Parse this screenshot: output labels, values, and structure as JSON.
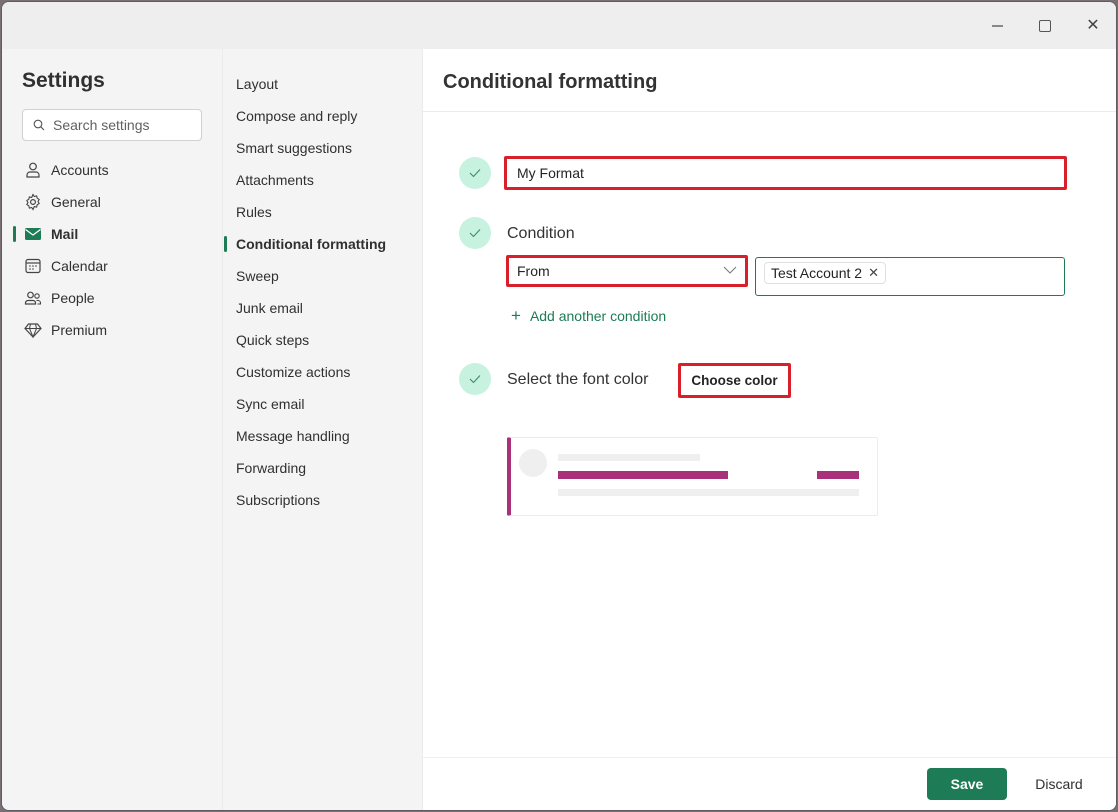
{
  "window": {
    "controls": {
      "minimize": "minimize-icon",
      "maximize": "maximize-icon",
      "close": "close-icon"
    }
  },
  "sidebar": {
    "title": "Settings",
    "search": {
      "placeholder": "Search settings",
      "value": ""
    },
    "items": [
      {
        "label": "Accounts",
        "icon": "person-icon",
        "active": false
      },
      {
        "label": "General",
        "icon": "gear-icon",
        "active": false
      },
      {
        "label": "Mail",
        "icon": "mail-icon",
        "active": true
      },
      {
        "label": "Calendar",
        "icon": "calendar-icon",
        "active": false
      },
      {
        "label": "People",
        "icon": "people-icon",
        "active": false
      },
      {
        "label": "Premium",
        "icon": "diamond-icon",
        "active": false
      }
    ]
  },
  "subnav": {
    "items": [
      {
        "label": "Layout"
      },
      {
        "label": "Compose and reply"
      },
      {
        "label": "Smart suggestions"
      },
      {
        "label": "Attachments"
      },
      {
        "label": "Rules"
      },
      {
        "label": "Conditional formatting",
        "active": true
      },
      {
        "label": "Sweep"
      },
      {
        "label": "Junk email"
      },
      {
        "label": "Quick steps"
      },
      {
        "label": "Customize actions"
      },
      {
        "label": "Sync email"
      },
      {
        "label": "Message handling"
      },
      {
        "label": "Forwarding"
      },
      {
        "label": "Subscriptions"
      }
    ]
  },
  "main": {
    "title": "Conditional formatting",
    "rule_name": {
      "value": "My Format"
    },
    "condition": {
      "label": "Condition",
      "field": "From",
      "recipients": [
        {
          "name": "Test Account 2"
        }
      ],
      "add_label": "Add another condition"
    },
    "font_color": {
      "label": "Select the font color",
      "button_label": "Choose color",
      "preview_color": "#a9317b"
    },
    "footer": {
      "save_label": "Save",
      "discard_label": "Discard"
    }
  },
  "colors": {
    "accent": "#1d7b55",
    "highlight": "#d91f2a",
    "check_bg": "#c7f2e0"
  }
}
